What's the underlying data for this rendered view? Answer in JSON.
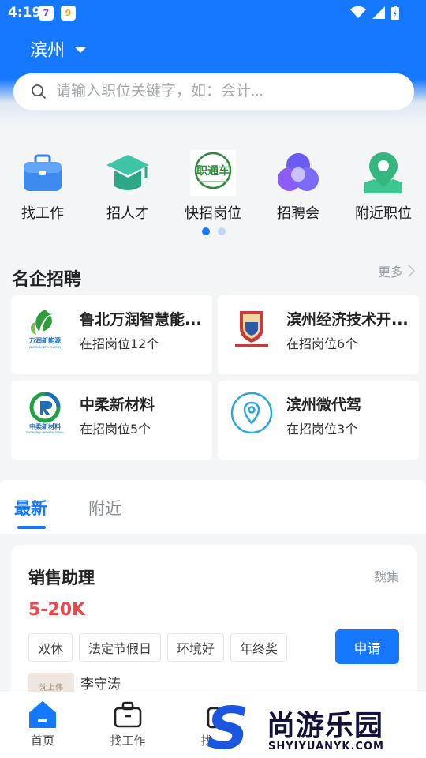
{
  "status_bar": {
    "time": "4:19",
    "app1": "7",
    "app2": "9"
  },
  "header": {
    "city": "滨州",
    "search_placeholder": "请输入职位关键字，如：会计..."
  },
  "quick_menu": [
    {
      "label": "找工作",
      "icon": "briefcase-icon"
    },
    {
      "label": "招人才",
      "icon": "graduation-cap-icon"
    },
    {
      "label": "快招岗位",
      "icon": "zhitongche-logo",
      "logo_text": "职通车"
    },
    {
      "label": "招聘会",
      "icon": "circles-icon"
    },
    {
      "label": "附近职位",
      "icon": "map-pin-icon"
    }
  ],
  "famous": {
    "title": "名企招聘",
    "more": "更多",
    "companies": [
      {
        "name": "鲁北万润智慧能...",
        "count": "在招岗位12个",
        "logo_text": "万润新能源",
        "logo_sub": "WANRUN NEW ENERGY"
      },
      {
        "name": "滨州经济技术开...",
        "count": "在招岗位6个",
        "logo_text": ""
      },
      {
        "name": "中柔新材料",
        "count": "在招岗位5个",
        "logo_text": "中柔新材料",
        "logo_sub": "ZHONGROU NEW MATERIAL"
      },
      {
        "name": "滨州微代驾",
        "count": "在招岗位3个",
        "logo_text": ""
      }
    ]
  },
  "tabs": [
    {
      "label": "最新"
    },
    {
      "label": "附近"
    }
  ],
  "job": {
    "title": "销售助理",
    "location": "魏集",
    "salary": "5-20K",
    "tags": [
      "双休",
      "法定节假日",
      "环境好",
      "年终奖"
    ],
    "apply": "申请",
    "recruiter": "李守涛",
    "avatar_text": "沈上伟"
  },
  "bottom_nav": [
    {
      "label": "首页"
    },
    {
      "label": "找工作"
    },
    {
      "label": "找"
    }
  ],
  "watermark": {
    "letter": "S",
    "text": "尚游乐园",
    "sub": "SHYIYUANYK.COM"
  },
  "colors": {
    "primary": "#1677ff",
    "salary": "#f0464c"
  }
}
